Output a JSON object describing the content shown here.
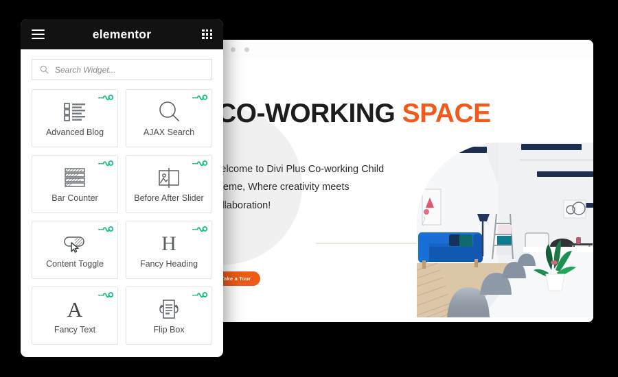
{
  "panel": {
    "brand": "elementor",
    "menu_icon": "hamburger-icon",
    "apps_icon": "grid-apps-icon",
    "search": {
      "placeholder": "Search Widget...",
      "value": "",
      "icon": "search-icon"
    },
    "badge_icon": "pro-squiggle-badge",
    "badge_color": "#14c07a",
    "widgets": [
      {
        "label": "Advanced Blog",
        "icon": "list-blog-icon",
        "pro": true
      },
      {
        "label": "AJAX Search",
        "icon": "magnifier-icon",
        "pro": true
      },
      {
        "label": "Bar Counter",
        "icon": "bar-counter-icon",
        "pro": true
      },
      {
        "label": "Before After Slider",
        "icon": "image-compare-icon",
        "pro": true
      },
      {
        "label": "Content Toggle",
        "icon": "toggle-cursor-icon",
        "pro": true
      },
      {
        "label": "Fancy Heading",
        "icon": "letter-h-icon",
        "pro": true
      },
      {
        "label": "Fancy Text",
        "icon": "letter-a-icon",
        "pro": true
      },
      {
        "label": "Flip Box",
        "icon": "flip-card-icon",
        "pro": true
      }
    ]
  },
  "browser": {
    "dots": [
      "dot-close",
      "dot-minimize",
      "dot-maximize"
    ],
    "hero": {
      "title_main": "CO-WORKING",
      "title_accent": "SPACE",
      "accent_color": "#f15a1b",
      "body": "Welcome to Divi Plus Co-working Child Theme, Where creativity meets collaboration!",
      "cta_label": "Take a Tour",
      "cta_color": "#f05a14",
      "photo_alt": "co-working-office-photo"
    }
  }
}
